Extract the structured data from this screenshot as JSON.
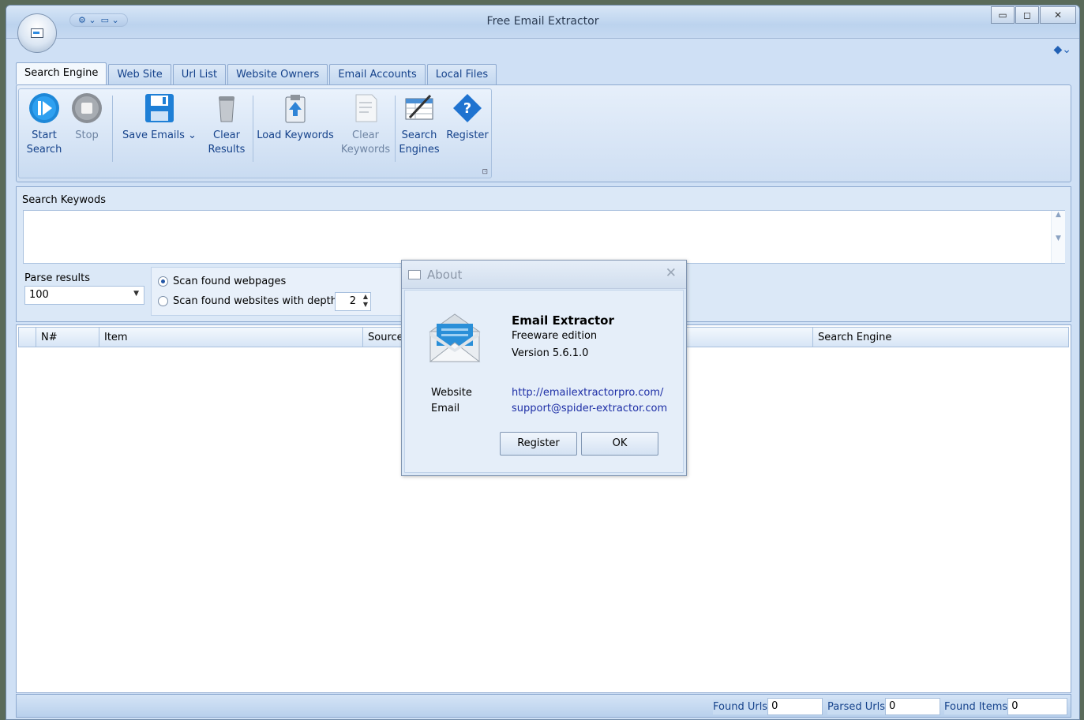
{
  "window": {
    "title": "Free Email Extractor",
    "buttons": {
      "minimize": "▭",
      "maximize": "◻",
      "close": "✕"
    }
  },
  "quick_access": {
    "item1": "⚙ ⌄",
    "item2": "▭ ⌄"
  },
  "tabs": [
    {
      "label": "Search Engine",
      "active": true
    },
    {
      "label": "Web Site"
    },
    {
      "label": "Url List"
    },
    {
      "label": "Website Owners"
    },
    {
      "label": "Email Accounts"
    },
    {
      "label": "Local Files"
    }
  ],
  "ribbon": {
    "start_search": "Start\nSearch",
    "stop": "Stop",
    "save_emails": "Save Emails ⌄",
    "clear_results": "Clear\nResults",
    "load_keywords": "Load Keywords",
    "clear_keywords": "Clear\nKeywords",
    "search_engines": "Search\nEngines",
    "register": "Register",
    "launcher": "⊡"
  },
  "search_panel": {
    "keywords_label": "Search Keywods",
    "keywords_value": "",
    "parse_results_label": "Parse results",
    "parse_results_value": "100",
    "radio_webpages": "Scan found webpages",
    "radio_websites": "Scan found websites with depth",
    "depth_value": "2"
  },
  "grid": {
    "columns": [
      "N#",
      "Item",
      "Source",
      "",
      "Search Engine"
    ]
  },
  "status": {
    "found_urls_label": "Found Urls",
    "found_urls_value": "0",
    "parsed_urls_label": "Parsed Urls",
    "parsed_urls_value": "0",
    "found_items_label": "Found Items",
    "found_items_value": "0"
  },
  "about_dialog": {
    "title": "About",
    "product": "Email Extractor",
    "edition": "Freeware edition",
    "version": "Version 5.6.1.0",
    "website_label": "Website",
    "email_label": "Email",
    "website_url": "http://emailextractorpro.com/",
    "email_address": "support@spider-extractor.com",
    "register_button": "Register",
    "ok_button": "OK"
  },
  "colors": {
    "accent": "#15428b",
    "link": "#1d2ea6",
    "ribbon_bg": "#cfdff3"
  }
}
